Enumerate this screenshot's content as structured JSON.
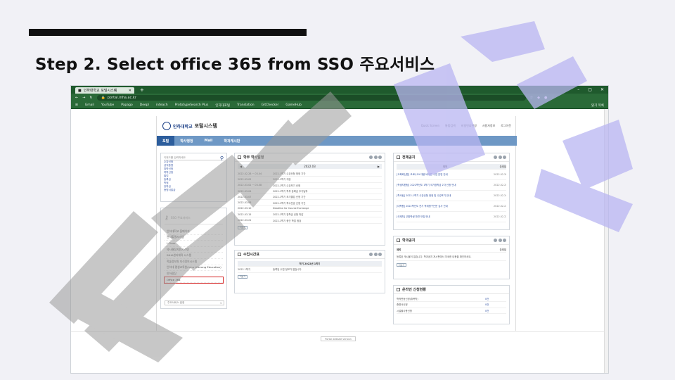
{
  "slide": {
    "title": "Step 2. Select office 365 from SSO 주요서비스"
  },
  "browser": {
    "tab_title": "인하대학교 포털시스템",
    "tab_plus": "+",
    "url": "portal.inha.ac.kr",
    "window_controls": [
      "–",
      "▢",
      "✕"
    ],
    "bookmarks": [
      "Gmail",
      "YouTube",
      "Papago",
      "Deepl",
      "inteach",
      "PrototypeSearch Plus",
      "인하대포털",
      "Translation",
      "GitChecker",
      "GameHub"
    ],
    "bookmarks_right": "읽기 목록"
  },
  "portal": {
    "logo_univ": "인하대학교",
    "logo_system": "포털시스템",
    "top_links": [
      "Quick Screen",
      "통합검색",
      "비밀번호변경",
      "사용자정보",
      "로그아웃"
    ],
    "nav": [
      "포털",
      "학사행정",
      "Mail",
      "학과게시판"
    ],
    "search": {
      "placeholder": "키워드를 입력하세요",
      "keywords": [
        "수강신청",
        "성적증명",
        "휴학신청",
        "복학신청",
        "졸업",
        "등록금",
        "학점",
        "장학금",
        "증명서발급"
      ]
    },
    "sso": {
      "header": "SSO 주요서비스",
      "services": [
        "인하대학교 홈페이지",
        "전자출결시스템",
        "I-Class",
        "의사결정지원시스템",
        "INHA센터체육 시스템",
        "학술정보원 지식정보시스템",
        "인하대 평생교육원(Inha LifeLong Education)",
        "인하광장",
        "Office 365"
      ],
      "footer": "주요서비스 설정"
    },
    "schedule": {
      "title": "학부 학사일정",
      "month": "2022.03",
      "prev": "◀",
      "next": "▶",
      "rows": [
        [
          "2022.02.28 ~ 03.04",
          "2022-1학기 수강신청 정정 기간"
        ],
        [
          "2022.03.02",
          "2022-1학기 개강"
        ],
        [
          "2022.03.02 ~ 03.08",
          "2022-1학기 수강포기 신청"
        ],
        [
          "2022.03.04",
          "2022-1학기 학부 등록금 추가납부"
        ],
        [
          "2022.03.07",
          "2022-1학기 조기졸업 신청 기간"
        ],
        [
          "2022.03.08",
          "2022-1학기 복수전공 신청 기간"
        ],
        [
          "2022.03.10",
          "Deadline for Course Exchange"
        ],
        [
          "2022.03.15",
          "2022-1학기 장학금 신청 마감"
        ],
        [
          "2022.03.21",
          "2022-1학기 중간 학업 점검"
        ]
      ],
      "more": "더보기"
    },
    "timetable": {
      "title": "수업시간표",
      "head": "학기 2022년 1학기",
      "row": [
        "2022 1학기",
        "등록된 수업 정보가 없습니다"
      ],
      "more": "더보기"
    },
    "notices": {
      "title": "전체공지",
      "head": [
        "제목",
        "등록일"
      ],
      "rows": [
        [
          "[교육혁신원] 코로나19 대응 비대면 수업 운영 안내",
          "2022.02.28"
        ],
        [
          "[학생지원팀] 2022학년도 1학기 국가장학금 2차 신청 안내",
          "2022.02.25"
        ],
        [
          "[학사팀] 2022-1학기 수강신청 정정 및 수강포기 안내",
          "2022.02.24"
        ],
        [
          "[대학원] 2022학년도 전기 학위청구논문 심사 안내",
          "2022.02.23"
        ],
        [
          "[국제처] 교환학생 파견 모집 안내",
          "2022.02.22"
        ]
      ]
    },
    "dept_notices": {
      "title": "학과공지",
      "head": [
        "제목",
        "등록일"
      ],
      "empty": "등록된 게시물이 없습니다. 학과공지 게시판에서 자세한 내용을 확인하세요.",
      "more": "더보기"
    },
    "online_status": {
      "title": "온라인 신청현황",
      "rows": [
        [
          "학적변동신청(휴복학)",
          "0건"
        ],
        [
          "증명서신청",
          "0건"
        ],
        [
          "시설물사용신청",
          "0건"
        ]
      ]
    },
    "footer": "Portal website version"
  }
}
